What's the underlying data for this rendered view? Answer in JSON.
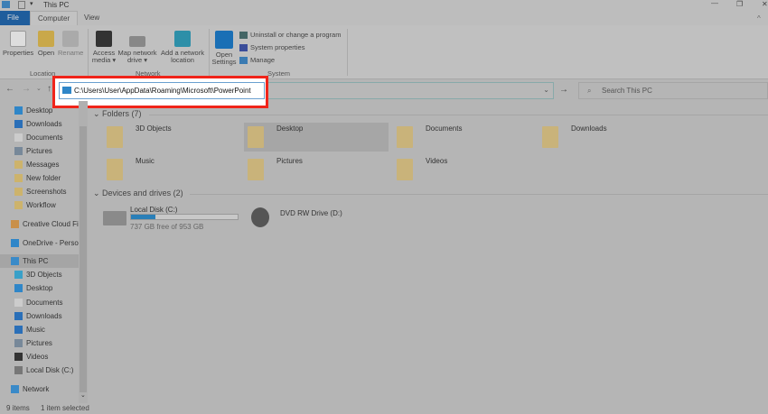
{
  "window": {
    "title": "This PC",
    "controls": [
      "minimize",
      "restore",
      "close"
    ]
  },
  "ribbon": {
    "tabs": [
      {
        "label": "File"
      },
      {
        "label": "Computer"
      },
      {
        "label": "View"
      }
    ],
    "location": {
      "label": "Location",
      "buttons": [
        {
          "label": "Properties"
        },
        {
          "label": "Open"
        },
        {
          "label": "Rename"
        }
      ]
    },
    "network": {
      "label": "Network",
      "buttons": [
        {
          "label": "Access media ▾"
        },
        {
          "label": "Map network drive ▾"
        },
        {
          "label": "Add a network location"
        }
      ]
    },
    "system": {
      "label": "System",
      "open_settings": "Open Settings",
      "items": [
        {
          "label": "Uninstall or change a program"
        },
        {
          "label": "System properties"
        },
        {
          "label": "Manage"
        }
      ]
    }
  },
  "address": {
    "path": "C:\\Users\\User\\AppData\\Roaming\\Microsoft\\PowerPoint",
    "search_placeholder": "Search This PC",
    "highlight_color": "#f0241a"
  },
  "sidebar": {
    "items": [
      {
        "label": "Desktop",
        "icon": "desktop"
      },
      {
        "label": "Downloads",
        "icon": "download"
      },
      {
        "label": "Documents",
        "icon": "document"
      },
      {
        "label": "Pictures",
        "icon": "picture"
      },
      {
        "label": "Messages",
        "icon": "folder"
      },
      {
        "label": "New folder",
        "icon": "folder"
      },
      {
        "label": "Screenshots",
        "icon": "folder"
      },
      {
        "label": "Workflow",
        "icon": "folder"
      },
      {
        "label": "Creative Cloud Fil",
        "icon": "creative-cloud"
      },
      {
        "label": "OneDrive - Persor",
        "icon": "cloud"
      },
      {
        "label": "This PC",
        "icon": "pc"
      },
      {
        "label": "3D Objects",
        "icon": "cube"
      },
      {
        "label": "Desktop",
        "icon": "desktop"
      },
      {
        "label": "Documents",
        "icon": "document"
      },
      {
        "label": "Downloads",
        "icon": "download"
      },
      {
        "label": "Music",
        "icon": "music"
      },
      {
        "label": "Pictures",
        "icon": "picture"
      },
      {
        "label": "Videos",
        "icon": "video"
      },
      {
        "label": "Local Disk (C:)",
        "icon": "disk"
      },
      {
        "label": "Network",
        "icon": "network"
      }
    ]
  },
  "content": {
    "folders_header": "Folders (7)",
    "folders": [
      {
        "label": "3D Objects"
      },
      {
        "label": "Desktop"
      },
      {
        "label": "Documents"
      },
      {
        "label": "Downloads"
      },
      {
        "label": "Music"
      },
      {
        "label": "Pictures"
      },
      {
        "label": "Videos"
      }
    ],
    "drives_header": "Devices and drives (2)",
    "drives": [
      {
        "label": "Local Disk (C:)",
        "free": "737 GB free of 953 GB",
        "used_fraction": 0.227
      },
      {
        "label": "DVD RW Drive (D:)"
      }
    ]
  },
  "status": {
    "items": "9 items",
    "selected": "1 item selected"
  }
}
